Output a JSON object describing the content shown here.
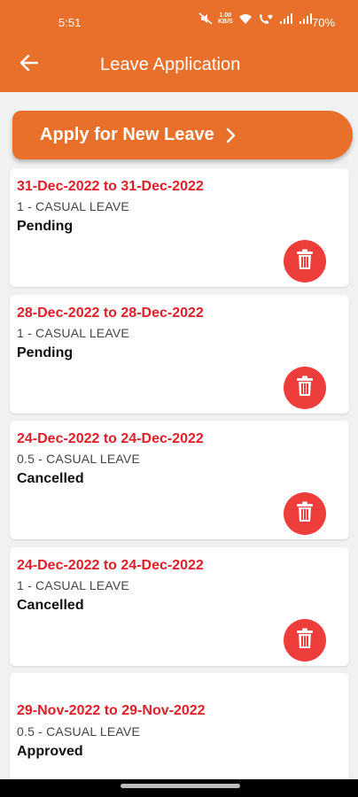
{
  "status_bar": {
    "time": "5:51",
    "battery": "70%",
    "icons": [
      "mute-icon",
      "data-speed-icon",
      "wifi-icon",
      "wifi-call-icon",
      "signal-icon",
      "signal-icon"
    ],
    "data_speed": "1.00\nKB/S"
  },
  "header": {
    "title": "Leave Application",
    "back_icon": "arrow-left-icon",
    "color": "#e8702a"
  },
  "apply_button": {
    "label": "Apply for New Leave",
    "icon": "chevron-right-icon"
  },
  "leaves": [
    {
      "dates": "31-Dec-2022 to 31-Dec-2022",
      "type": "1 - CASUAL LEAVE",
      "status": "Pending",
      "deletable": true
    },
    {
      "dates": "28-Dec-2022 to 28-Dec-2022",
      "type": "1 - CASUAL LEAVE",
      "status": "Pending",
      "deletable": true
    },
    {
      "dates": "24-Dec-2022 to 24-Dec-2022",
      "type": "0.5 - CASUAL LEAVE",
      "status": "Cancelled",
      "deletable": true
    },
    {
      "dates": "24-Dec-2022 to 24-Dec-2022",
      "type": "1 - CASUAL LEAVE",
      "status": "Cancelled",
      "deletable": true
    },
    {
      "dates": "29-Nov-2022 to 29-Nov-2022",
      "type": "0.5 - CASUAL LEAVE",
      "status": "Approved",
      "deletable": false
    }
  ],
  "colors": {
    "date_text": "#e01e28",
    "delete_button": "#ee3e3b",
    "background": "#f1f1f1"
  }
}
